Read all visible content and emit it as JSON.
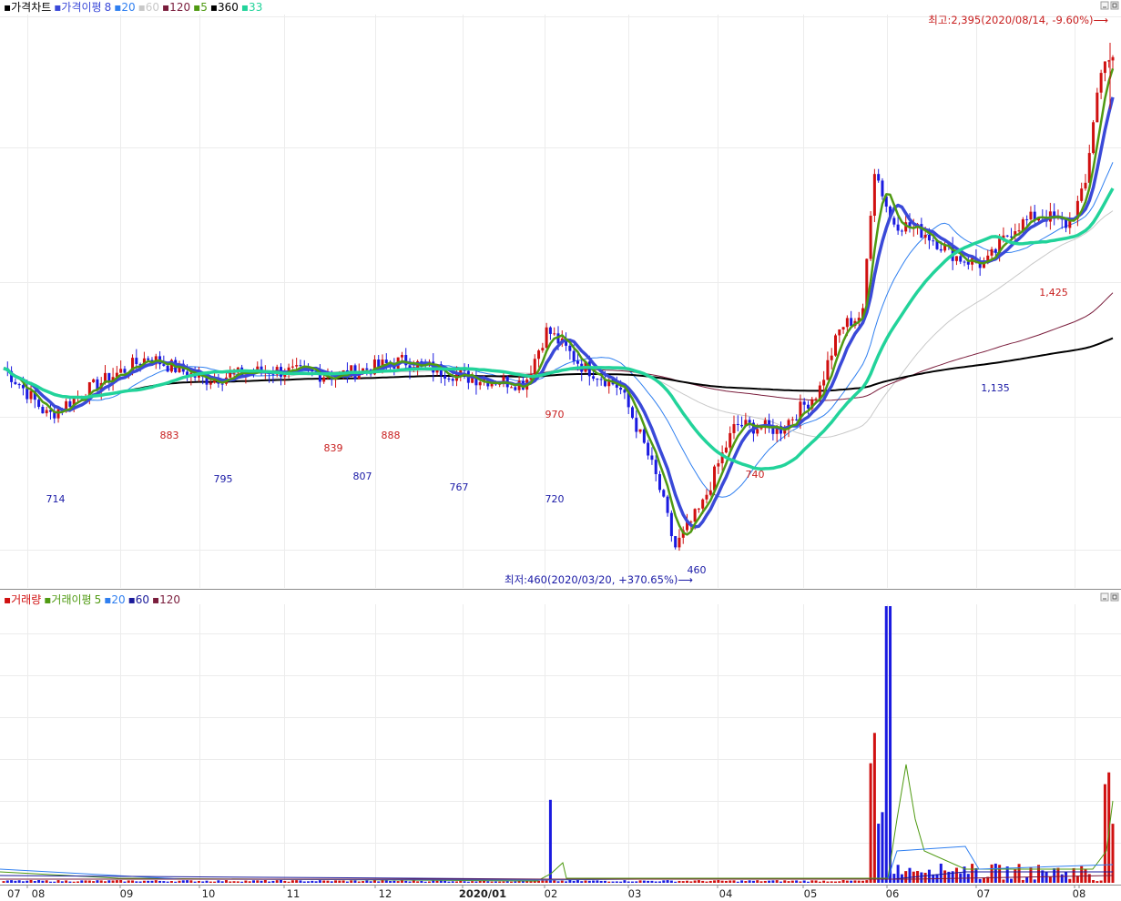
{
  "price_panel": {
    "legend": [
      {
        "text": "▪가격차트",
        "color": "#000000"
      },
      {
        "text": "▪가격이평",
        "color": "#3a49d8"
      },
      {
        "text": "8",
        "color": "#3a49d8"
      },
      {
        "text": "▪20",
        "color": "#2f7ff0"
      },
      {
        "text": "▪60",
        "color": "#c8c8c8"
      },
      {
        "text": "▪120",
        "color": "#7a1d3c"
      },
      {
        "text": "▪5",
        "color": "#4f9a12"
      },
      {
        "text": "▪360",
        "color": "#000000"
      },
      {
        "text": "▪33",
        "color": "#22d39a"
      }
    ],
    "high_note": "최고:2,395(2020/08/14, -9.60%)⟶",
    "low_note": "최저:460(2020/03/20, +370.65%)⟶"
  },
  "volume_panel": {
    "legend": [
      {
        "text": "▪거래량",
        "color": "#d01010"
      },
      {
        "text": "▪거래이평",
        "color": "#4f9a12"
      },
      {
        "text": "5",
        "color": "#4f9a12"
      },
      {
        "text": "▪20",
        "color": "#2f7ff0"
      },
      {
        "text": "▪60",
        "color": "#1a1a9a"
      },
      {
        "text": "▪120",
        "color": "#7a1d3c"
      }
    ]
  },
  "x_axis": {
    "labels": [
      {
        "text": "07",
        "bold": false
      },
      {
        "text": "08",
        "bold": false
      },
      {
        "text": "09",
        "bold": false
      },
      {
        "text": "10",
        "bold": false
      },
      {
        "text": "11",
        "bold": false
      },
      {
        "text": "12",
        "bold": false
      },
      {
        "text": "2020/01",
        "bold": true
      },
      {
        "text": "02",
        "bold": false
      },
      {
        "text": "03",
        "bold": false
      },
      {
        "text": "04",
        "bold": false
      },
      {
        "text": "05",
        "bold": false
      },
      {
        "text": "06",
        "bold": false
      },
      {
        "text": "07",
        "bold": false
      },
      {
        "text": "08",
        "bold": false
      }
    ]
  },
  "chart_data": {
    "type": "candlestick",
    "period": "2019/07 – 2020/08 (daily)",
    "ylim": [
      420,
      2600
    ],
    "annotations": [
      {
        "label": "714",
        "date": "2019/07 late",
        "value": 714,
        "kind": "low"
      },
      {
        "label": "883",
        "date": "2019/09",
        "value": 883,
        "kind": "high"
      },
      {
        "label": "795",
        "date": "2019/10",
        "value": 795,
        "kind": "low"
      },
      {
        "label": "839",
        "date": "2019/11",
        "value": 839,
        "kind": "high"
      },
      {
        "label": "807",
        "date": "2019/12",
        "value": 807,
        "kind": "low"
      },
      {
        "label": "888",
        "date": "2019/12",
        "value": 888,
        "kind": "high"
      },
      {
        "label": "767",
        "date": "2020/01",
        "value": 767,
        "kind": "low"
      },
      {
        "label": "970",
        "date": "2020/02",
        "value": 970,
        "kind": "high"
      },
      {
        "label": "720",
        "date": "2020/02",
        "value": 720,
        "kind": "low"
      },
      {
        "label": "460",
        "date": "2020/03/20",
        "value": 460,
        "kind": "low"
      },
      {
        "label": "740",
        "date": "2020/04",
        "value": 740,
        "kind": "high"
      },
      {
        "label": "1,135",
        "date": "2020/07",
        "value": 1135,
        "kind": "low"
      },
      {
        "label": "1,425",
        "date": "2020/07",
        "value": 1425,
        "kind": "high"
      }
    ],
    "extremes": {
      "high": {
        "value": 2395,
        "date": "2020/08/14",
        "pct": "-9.60%"
      },
      "low": {
        "value": 460,
        "date": "2020/03/20",
        "pct": "+370.65%"
      }
    },
    "price_anchors": [
      {
        "month": "2019/07",
        "close": 820
      },
      {
        "month": "2019/08",
        "close": 770
      },
      {
        "month": "2019/09",
        "close": 850
      },
      {
        "month": "2019/10",
        "close": 820
      },
      {
        "month": "2019/11",
        "close": 815
      },
      {
        "month": "2019/12",
        "close": 835
      },
      {
        "month": "2020/01",
        "close": 790
      },
      {
        "month": "2020/02",
        "close": 840
      },
      {
        "month": "2020/03",
        "close": 500
      },
      {
        "month": "2020/04",
        "close": 660
      },
      {
        "month": "2020/05",
        "close": 700
      },
      {
        "month": "2020/06",
        "close": 1280
      },
      {
        "month": "2020/07",
        "close": 1180
      },
      {
        "month": "2020/08",
        "close": 2200
      }
    ],
    "moving_averages": [
      {
        "name": "8",
        "color": "#3a49d8"
      },
      {
        "name": "20",
        "color": "#2f7ff0"
      },
      {
        "name": "60",
        "color": "#c8c8c8"
      },
      {
        "name": "120",
        "color": "#7a1d3c"
      },
      {
        "name": "5",
        "color": "#4f9a12"
      },
      {
        "name": "360",
        "color": "#000000"
      },
      {
        "name": "33",
        "color": "#22d39a"
      }
    ],
    "volume_spikes": [
      {
        "month": "2020/02",
        "relative": 0.32
      },
      {
        "month": "2020/06",
        "relative": 1.0
      },
      {
        "month": "2020/08",
        "relative": 0.65
      }
    ]
  }
}
